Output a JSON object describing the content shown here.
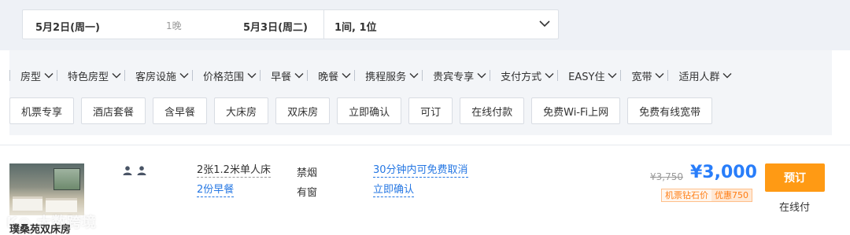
{
  "search": {
    "checkin": "5月2日(周一)",
    "nights": "1晚",
    "checkout": "5月3日(周二)",
    "rooms_guests": "1间, 1位"
  },
  "filters": [
    "房型",
    "特色房型",
    "客房设施",
    "价格范围",
    "早餐",
    "晚餐",
    "携程服务",
    "贵宾专享",
    "支付方式",
    "EASY住",
    "宽带",
    "适用人群"
  ],
  "tags": [
    "机票专享",
    "酒店套餐",
    "含早餐",
    "大床房",
    "双床房",
    "立即确认",
    "可订",
    "在线付款",
    "免费Wi-Fi上网",
    "免费有线宽带"
  ],
  "room": {
    "name": "璞桑苑双床房",
    "watermark": "K◎ 大数跨境",
    "bed": "2张1.2米单人床",
    "breakfast": "2份早餐",
    "smoking": "禁烟",
    "window": "有窗",
    "cancel_policy": "30分钟内可免费取消",
    "confirm": "立即确认",
    "original_price": "¥3,750",
    "price": "¥3,000",
    "promo_label": "机票钻石价",
    "promo_discount": "优惠750",
    "book_label": "预订",
    "payment": "在线付"
  },
  "icons": {
    "chevron": "chevron-down-icon",
    "guest": "person-icon"
  },
  "colors": {
    "link_blue": "#2577e3",
    "price_blue": "#287dfa",
    "book_orange": "#ff9a14",
    "promo_orange": "#ff7d13"
  }
}
